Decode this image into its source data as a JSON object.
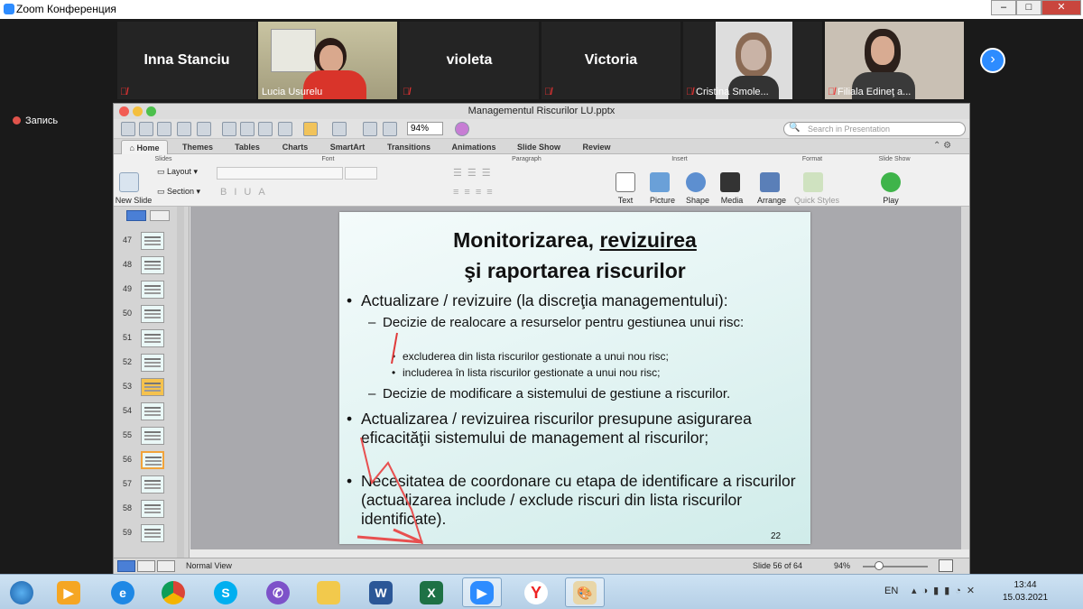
{
  "zoom": {
    "window_title": "Zoom Конференция",
    "recording_label": "Запись",
    "participants": [
      {
        "name": "Inna Stanciu",
        "video": false
      },
      {
        "name": "Lucia Usurelu",
        "video": true
      },
      {
        "name": "violeta",
        "video": false
      },
      {
        "name": "Victoria",
        "video": false
      },
      {
        "name": "Cristina Smole...",
        "video": true
      },
      {
        "name": "Filiala Edineţ a...",
        "video": true
      }
    ],
    "next_arrow": "›"
  },
  "ppt": {
    "file_title": "Managementul Riscurilor LU.pptx",
    "zoom_value": "94%",
    "search_placeholder": "Search in Presentation",
    "tabs": [
      "Home",
      "Themes",
      "Tables",
      "Charts",
      "SmartArt",
      "Transitions",
      "Animations",
      "Slide Show",
      "Review"
    ],
    "ribbon_groups": {
      "slides": "Slides",
      "font": "Font",
      "paragraph": "Paragraph",
      "insert": "Insert",
      "format": "Format",
      "slide_show": "Slide Show"
    },
    "ribbon_buttons": {
      "new_slide": "New Slide",
      "layout": "Layout",
      "section": "Section",
      "text": "Text",
      "picture": "Picture",
      "shape": "Shape",
      "media": "Media",
      "arrange": "Arrange",
      "quick_styles": "Quick Styles",
      "play": "Play"
    },
    "thumbnails": [
      "47",
      "48",
      "49",
      "50",
      "51",
      "52",
      "53",
      "54",
      "55",
      "56",
      "57",
      "58",
      "59"
    ],
    "selected_thumbnail": "56",
    "status": {
      "view": "Normal View",
      "slide_of": "Slide 56 of 64",
      "zoom": "94%"
    }
  },
  "slide": {
    "title_part1": "Monitorizarea, ",
    "title_underlined": "revizuirea",
    "title_line2": "şi raportarea riscurilor",
    "bullet1": "Actualizare / revizuire (la discreţia managementului):",
    "sub1": "Decizie de realocare a resurselor pentru gestiunea unui risc:",
    "subsub1": "excluderea din lista riscurilor gestionate a unui nou risc;",
    "subsub2": "includerea în lista riscurilor gestionate a unui nou risc;",
    "sub2": "Decizie de modificare a sistemului de gestiune a riscurilor.",
    "bullet2": "Actualizarea / revizuirea riscurilor presupune asigurarea eficacităţii sistemului de management al riscurilor;",
    "bullet3": "Necesitatea de coordonare cu etapa de identificare a riscurilor (actualizarea include / exclude riscuri din lista riscurilor identificate).",
    "page_number": "22"
  },
  "taskbar": {
    "language": "EN",
    "time": "13:44",
    "date": "15.03.2021"
  }
}
